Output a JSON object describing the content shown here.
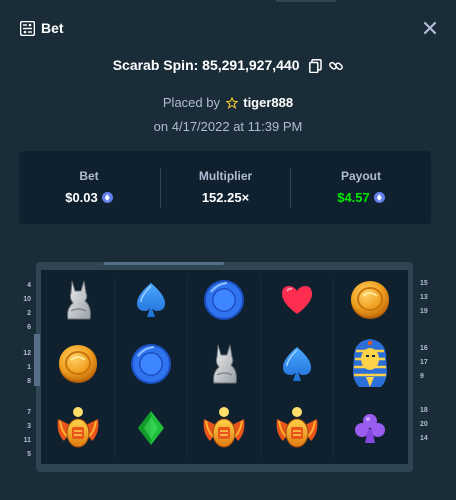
{
  "header": {
    "title": "Bet",
    "icon": "bet-slip-icon",
    "close_icon": "close-icon"
  },
  "bet_info": {
    "game_id": "Scarab Spin: 85,291,927,440",
    "placed_by_prefix": "Placed by",
    "username": "tiger888",
    "date": "on 4/17/2022 at 11:39 PM"
  },
  "stats": {
    "bet_label": "Bet",
    "bet_value": "$0.03",
    "multiplier_label": "Multiplier",
    "multiplier_value": "152.25×",
    "payout_label": "Payout",
    "payout_value": "$4.57",
    "currency_icon": "ethereum-icon",
    "payout_color": "#00e701"
  },
  "reels": [
    [
      "cat-statue",
      "coin",
      "scarab"
    ],
    [
      "spade",
      "blue-ring",
      "diamond"
    ],
    [
      "blue-ring",
      "cat-statue",
      "scarab"
    ],
    [
      "heart",
      "spade",
      "scarab"
    ],
    [
      "coin",
      "pharaoh",
      "club"
    ]
  ],
  "paylines_left": [
    [
      "4",
      "10",
      "2",
      "6"
    ],
    [
      "12",
      "1",
      "8"
    ],
    [
      "7",
      "3",
      "11",
      "5"
    ]
  ],
  "paylines_right": [
    [
      "15",
      "13",
      "19"
    ],
    [
      "16",
      "17",
      "9"
    ],
    [
      "18",
      "20",
      "14"
    ]
  ],
  "colors": {
    "background": "#1a2c38",
    "panel": "#0f212e",
    "border": "#2f4553",
    "muted_text": "#b1bad3"
  }
}
